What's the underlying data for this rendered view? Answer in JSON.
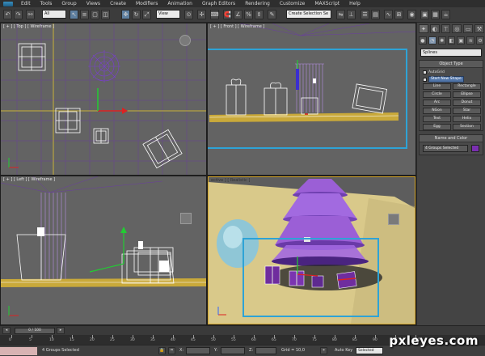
{
  "menu": [
    "Edit",
    "Tools",
    "Group",
    "Views",
    "Create",
    "Modifiers",
    "Animation",
    "Graph Editors",
    "Rendering",
    "Customize",
    "MAXScript",
    "Help"
  ],
  "toolbar": {
    "selection_filter": "All",
    "reference_coord": "View",
    "named_selection_placeholder": "Create Selection Se"
  },
  "viewports": {
    "top": "[ + ] [ Top ] [ Wireframe ]",
    "front": "[ + ] [ Front ] [ Wireframe ]",
    "left": "[ + ] [ Left ] [ Wireframe ]",
    "perspective": "ective ] [ Realistic ]"
  },
  "command_panel": {
    "category": "Splines",
    "object_type_header": "Object Type",
    "autogrid_label": "AutoGrid",
    "start_new_shape_label": "Start New Shape",
    "object_buttons": [
      "Line",
      "Rectangle",
      "Circle",
      "Ellipse",
      "Arc",
      "Donut",
      "NGon",
      "Star",
      "Text",
      "Helix",
      "Egg",
      "Section"
    ],
    "name_color_header": "Name and Color",
    "name_value": "4 Groups Selected"
  },
  "timeline": {
    "slider": "0 / 100",
    "ticks": [
      "0",
      "5",
      "10",
      "15",
      "20",
      "25",
      "30",
      "35",
      "40",
      "45",
      "50",
      "55",
      "60",
      "65",
      "70",
      "75",
      "80",
      "85",
      "90",
      "95",
      "100"
    ]
  },
  "status": {
    "selection": "4 Groups Selected",
    "x_label": "X:",
    "y_label": "Y:",
    "z_label": "Z:",
    "grid": "Grid = 10,0",
    "autokey": "Auto Key",
    "autokey_value": "Selected"
  },
  "watermark": "pxleyes.com",
  "colors": {
    "viewport_bg": "#636363",
    "perspective_floor": "#d9c98a",
    "tree_purple": "#9b5fd6",
    "gift_purple": "#6f2d9e",
    "highlight_cyan": "#2ea3d6",
    "floor_yellow": "#c9a93a",
    "grid_purple": "#6c34b0"
  }
}
